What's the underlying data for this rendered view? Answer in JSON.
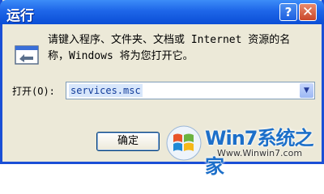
{
  "window": {
    "title": "运行",
    "help_label": "?",
    "close_label": "✕"
  },
  "description": {
    "line1": "请键入程序、文件夹、文档或 Internet 资源的名",
    "line2": "称，Windows 将为您打开它。"
  },
  "open_field": {
    "label": "打开(O):",
    "value": "services.msc",
    "dropdown_icon": "chevron-down-icon"
  },
  "buttons": {
    "ok_label": "确定"
  },
  "watermark": {
    "brand": "Win7系统之家",
    "url": "Www.Winwin7.com"
  },
  "colors": {
    "titlebar": "#0a4ed6",
    "close": "#c9472b",
    "watermark": "#1c6fc9"
  }
}
